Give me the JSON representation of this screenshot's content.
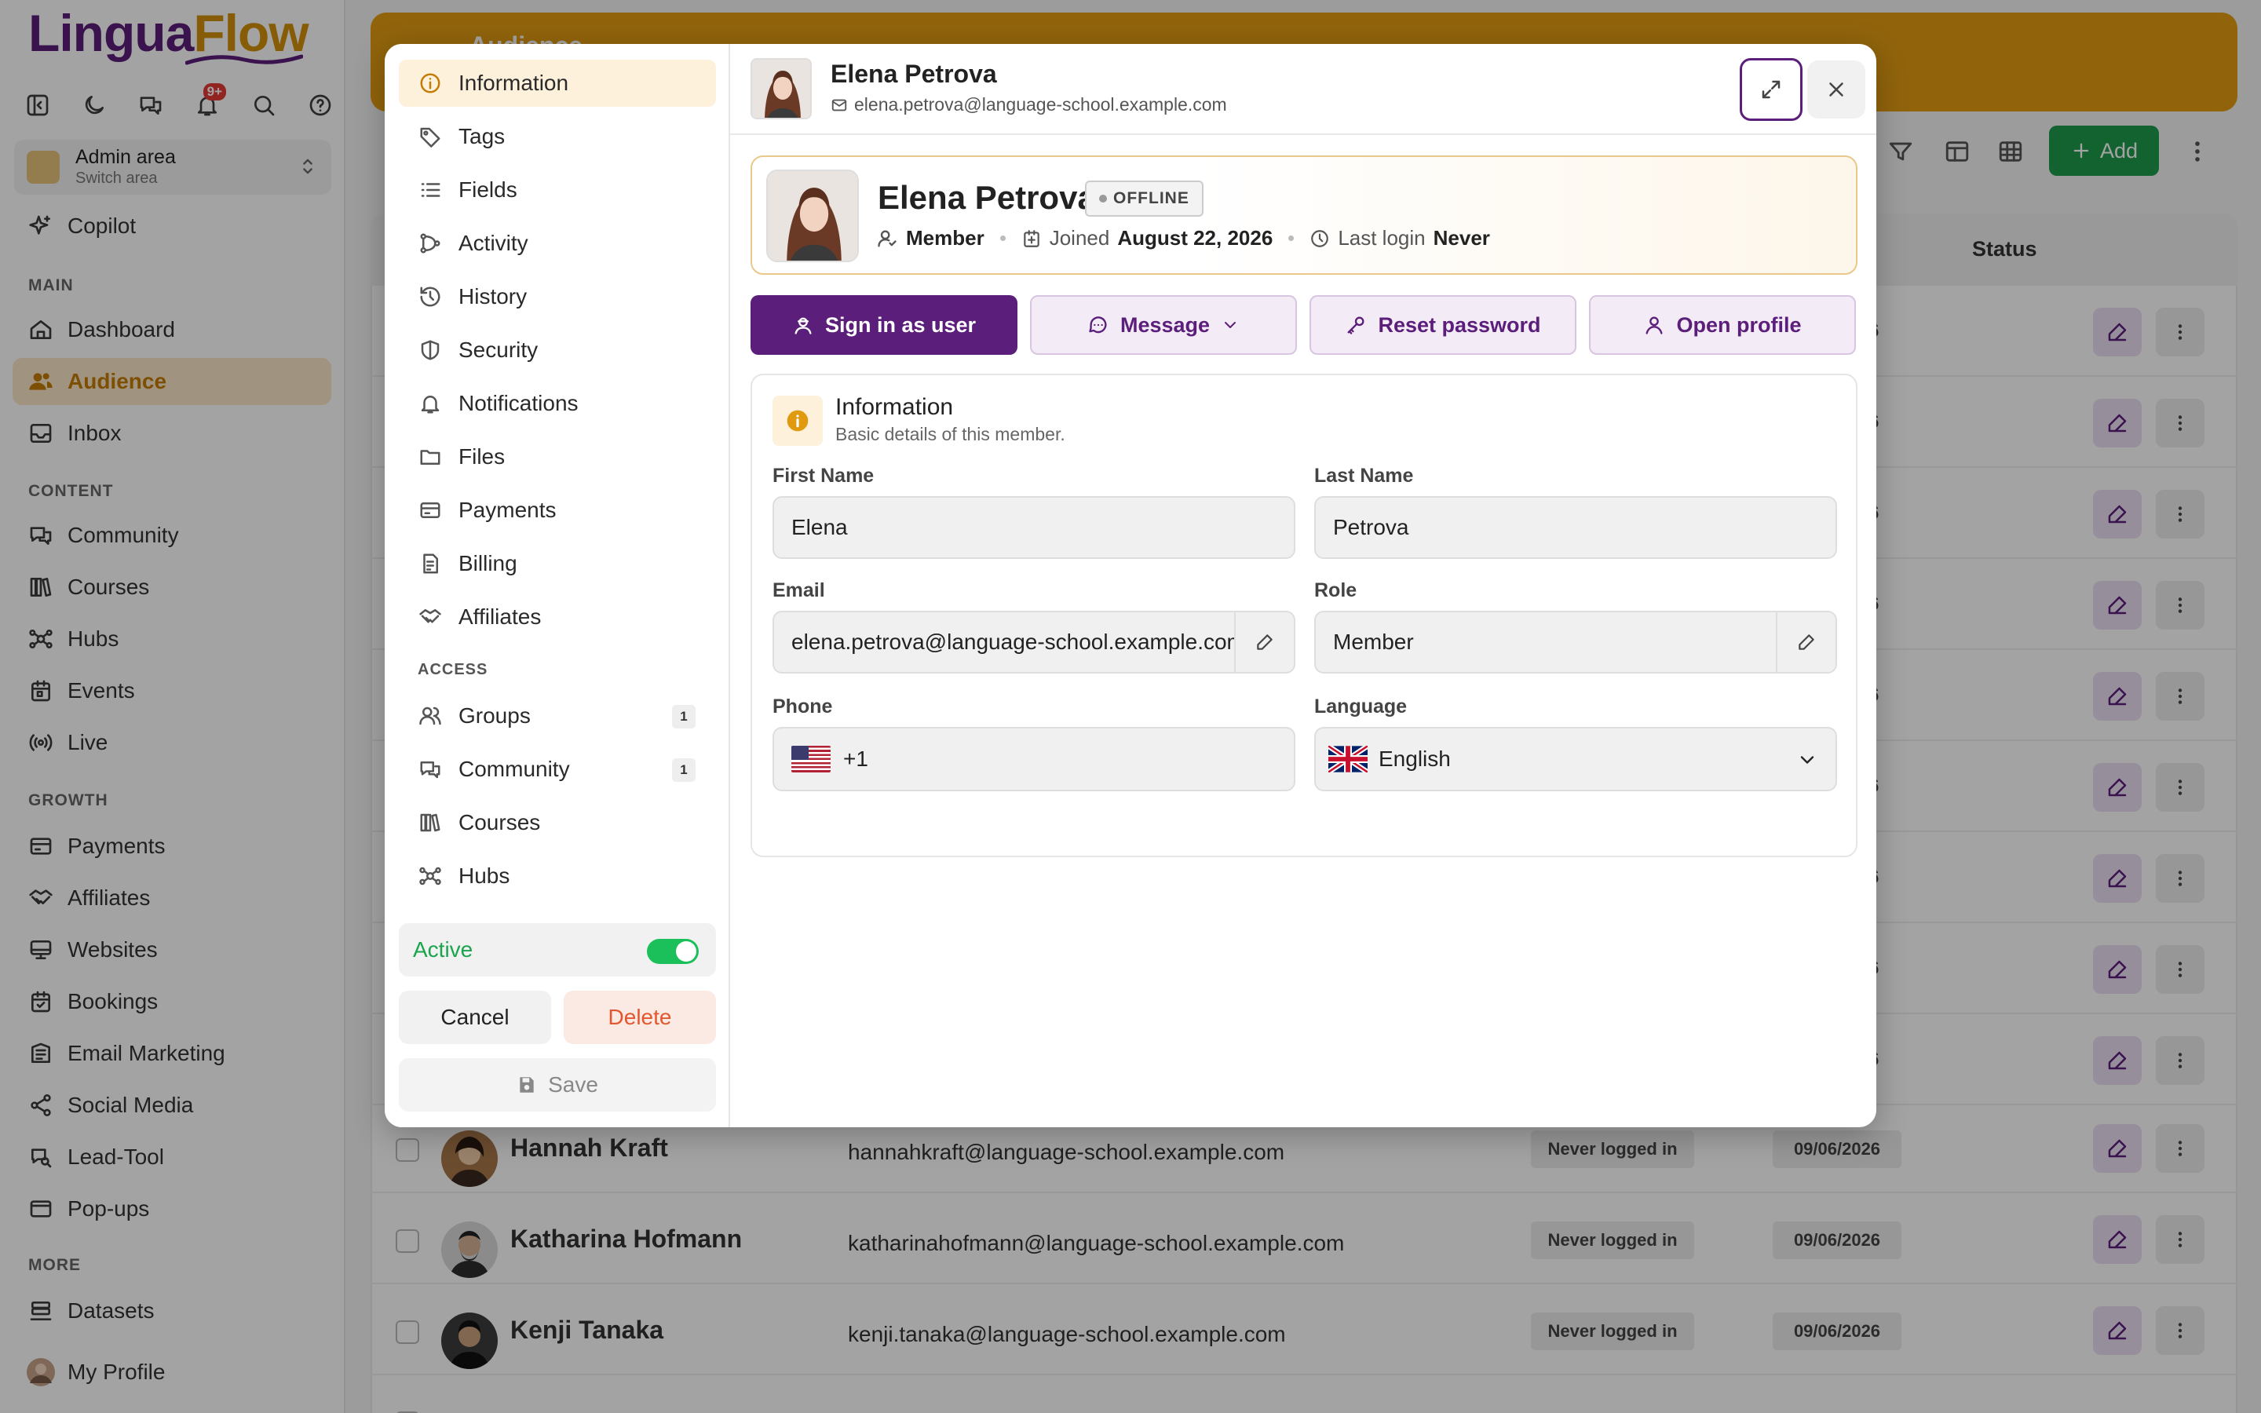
{
  "app": {
    "logo_a": "Lingua",
    "logo_b": "Flow",
    "notif_count": "9+",
    "area": {
      "title": "Admin area",
      "subtitle": "Switch area"
    },
    "sidebar": {
      "copilot": "Copilot",
      "sections": {
        "main": "MAIN",
        "content": "CONTENT",
        "growth": "GROWTH",
        "more": "MORE"
      },
      "items": {
        "dashboard": "Dashboard",
        "audience": "Audience",
        "inbox": "Inbox",
        "community": "Community",
        "courses": "Courses",
        "hubs": "Hubs",
        "events": "Events",
        "live": "Live",
        "payments": "Payments",
        "affiliates": "Affiliates",
        "websites": "Websites",
        "bookings": "Bookings",
        "email_marketing": "Email Marketing",
        "social_media": "Social Media",
        "lead_tool": "Lead-Tool",
        "popups": "Pop-ups",
        "datasets": "Datasets",
        "my_profile": "My Profile"
      }
    },
    "banner_title": "Audience",
    "add_label": "Add",
    "table": {
      "status_header": "Status",
      "partial_suffix": "6",
      "rows": [
        {
          "name": "Hannah Kraft",
          "email": "hannahkraft@language-school.example.com",
          "status": "Never logged in",
          "date": "09/06/2026"
        },
        {
          "name": "Katharina Hofmann",
          "email": "katharinahofmann@language-school.example.com",
          "status": "Never logged in",
          "date": "09/06/2026"
        },
        {
          "name": "Kenji Tanaka",
          "email": "kenji.tanaka@language-school.example.com",
          "status": "Never logged in",
          "date": "09/06/2026"
        }
      ]
    }
  },
  "modal": {
    "menu": {
      "information": "Information",
      "tags": "Tags",
      "fields": "Fields",
      "activity": "Activity",
      "history": "History",
      "security": "Security",
      "notifications": "Notifications",
      "files": "Files",
      "payments": "Payments",
      "billing": "Billing",
      "affiliates": "Affiliates",
      "access_section": "ACCESS",
      "groups": "Groups",
      "groups_count": "1",
      "community": "Community",
      "community_count": "1",
      "courses": "Courses",
      "hubs": "Hubs"
    },
    "active_label": "Active",
    "active_on": true,
    "cancel": "Cancel",
    "delete": "Delete",
    "save": "Save",
    "header": {
      "name": "Elena Petrova",
      "email": "elena.petrova@language-school.example.com"
    },
    "profile": {
      "name": "Elena Petrova",
      "status": "OFFLINE",
      "role": "Member",
      "joined_label": "Joined",
      "joined_date": "August 22, 2026",
      "last_login_label": "Last login",
      "last_login": "Never"
    },
    "actions": {
      "sign_in": "Sign in as user",
      "message": "Message",
      "reset": "Reset password",
      "open": "Open profile"
    },
    "info": {
      "title": "Information",
      "subtitle": "Basic details of this member.",
      "first_name_label": "First Name",
      "first_name": "Elena",
      "last_name_label": "Last Name",
      "last_name": "Petrova",
      "email_label": "Email",
      "email": "elena.petrova@language-school.example.com",
      "role_label": "Role",
      "role": "Member",
      "phone_label": "Phone",
      "phone": "+1",
      "language_label": "Language",
      "language": "English"
    }
  },
  "colors": {
    "brand": "#5b1e7a",
    "accent": "#e39d14",
    "success": "#1cc05a",
    "danger": "#e4572e"
  }
}
